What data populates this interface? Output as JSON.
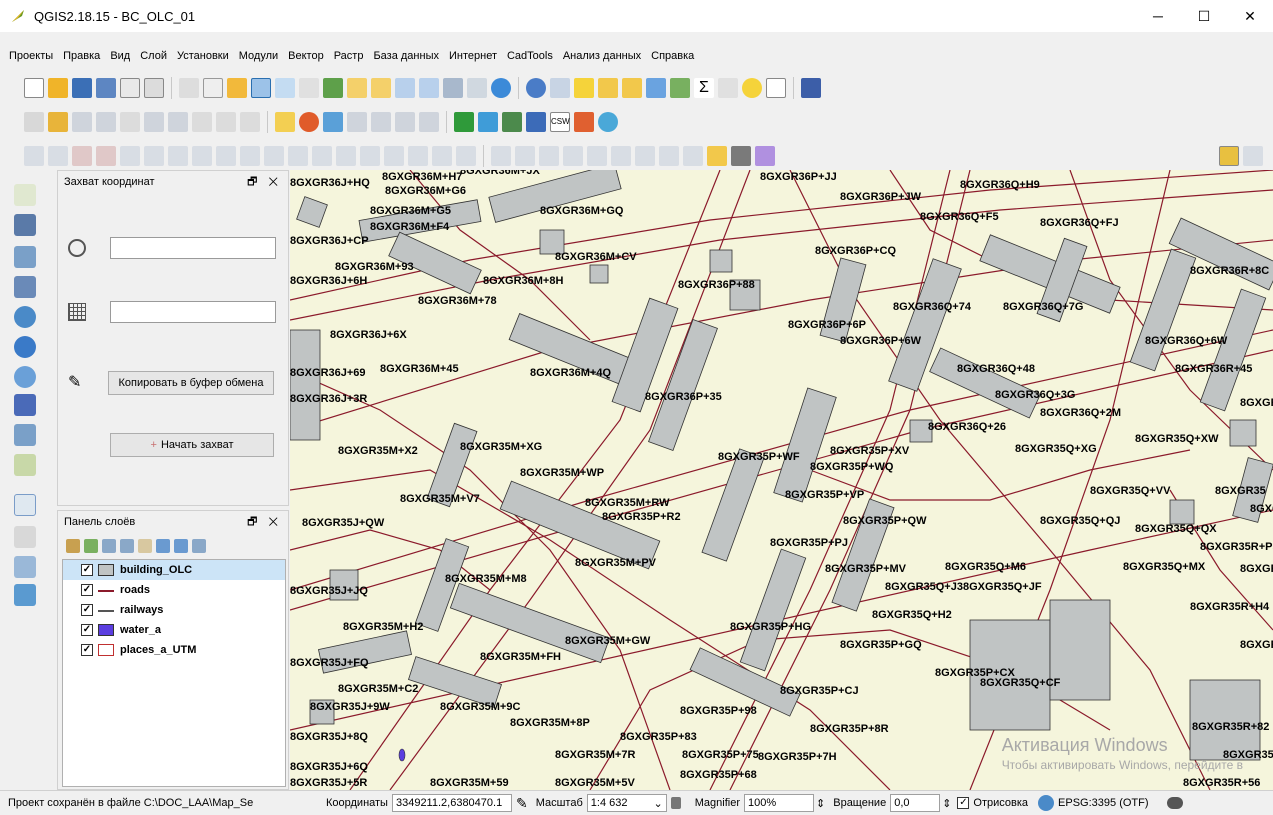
{
  "window": {
    "title": "QGIS2.18.15 - BC_OLC_01",
    "min_glyph": "─",
    "max_glyph": "☐",
    "close_glyph": "✕"
  },
  "menu": [
    "Проекты",
    "Правка",
    "Вид",
    "Слой",
    "Установки",
    "Модули",
    "Вектор",
    "Растр",
    "База данных",
    "Интернет",
    "CadTools",
    "Анализ данных",
    "Справка"
  ],
  "capture_panel": {
    "title": "Захват координат",
    "controls": "🗗 ✕",
    "copy_button": "Копировать в буфер обмена",
    "start_button": "Начать захват"
  },
  "layers_panel": {
    "title": "Панель слоёв",
    "controls": "🗗 ✕",
    "layers": [
      {
        "name": "building_OLC",
        "checked": true,
        "symbol": "building"
      },
      {
        "name": "roads",
        "checked": true,
        "symbol": "road"
      },
      {
        "name": "railways",
        "checked": true,
        "symbol": "rail"
      },
      {
        "name": "water_a",
        "checked": true,
        "symbol": "water"
      },
      {
        "name": "places_a_UTM",
        "checked": true,
        "symbol": "place"
      }
    ]
  },
  "map": {
    "labels": [
      "8GXGR36J+HQ",
      "8GXGR36M+H7",
      "8GXGR36M+JX",
      "8GXGR36P+JJ",
      "8GXGR36Q+H9",
      "8GXGR36M+G6",
      "8GXGR36M+G5",
      "8GXGR36M+GQ",
      "8GXGR36P+JW",
      "8GXGR36Q+F5",
      "8GXGR36Q+FJ",
      "8GXGR36M+F4",
      "8GXGR36J+CP",
      "8GXGR36M+CV",
      "8GXGR36P+CQ",
      "8GXGR36R+8C",
      "8GXGR36M+93",
      "8GXGR36M+8H",
      "8GXGR36P+88",
      "8GXGR36J+6H",
      "8GXGR36M+78",
      "8GXGR36Q+74",
      "8GXGR36Q+7G",
      "8GXGR36P+6P",
      "8GXGR36J+6X",
      "8GXGR36P+6W",
      "8GXGR36Q+6W",
      "8GXGR36J+69",
      "8GXGR36M+45",
      "8GXGR36M+4Q",
      "8GXGR36Q+48",
      "8GXGR36R+45",
      "8GXGR36Q+3G",
      "8GXGR36J+3R",
      "8GXGR36P+35",
      "8GXGR36Q+2M",
      "8GXGR36Q+26",
      "8GXGR3",
      "8GXGR35M+X2",
      "8GXGR35M+XG",
      "8GXGR35P+XV",
      "8GXGR35Q+XW",
      "8GXGR35M+WP",
      "8GXGR35P+WF",
      "8GXGR35P+WQ",
      "8GXGR35Q+XG",
      "8GXGR35M+V7",
      "8GXGR35M+RW",
      "8GXGR35P+VP",
      "8GXGR35Q+VV",
      "8GXGR35",
      "8GXGR35P+R2",
      "8GXGR35J+QW",
      "8GXGR35P+QW",
      "8GXGR35Q+QJ",
      "8GXGR35Q+QX",
      "8GXG",
      "8GXGR35P+PJ",
      "8GXGR35R+P5",
      "8GXGR35M+PV",
      "8GXGR35P+MV",
      "8GXGR35Q+M6",
      "8GXGR35Q+MX",
      "8GXGR",
      "8GXGR35J+JQ",
      "8GXGR35M+M8",
      "8GXGR35Q+J3",
      "8GXGR35Q+JF",
      "8GXGR35R+H4",
      "8GXGR35M+H2",
      "8GXGR35Q+H2",
      "8GXGR35P+HG",
      "8GXGR35M+GW",
      "8GXGR35P+GQ",
      "8GXGR",
      "8GXGR35M+FH",
      "8GXGR35J+FQ",
      "8GXGR35P+CX",
      "8GXGR35Q+CF",
      "8GXGR35M+C2",
      "8GXGR35P+CJ",
      "8GXGR35J+9W",
      "8GXGR35M+9C",
      "8GXGR35P+98",
      "8GXGR35M+8P",
      "8GXGR35P+8R",
      "8GXGR35R+82",
      "8GXGR35J+8Q",
      "8GXGR35P+83",
      "8GXGR35M+7R",
      "8GXGR35P+75",
      "8GXGR35P+7H",
      "8GXGR35R-",
      "8GXGR35J+6Q",
      "8GXGR35P+68",
      "8GXGR35J+5R",
      "8GXGR35M+59",
      "8GXGR35M+5V",
      "8GXGR35R+56"
    ]
  },
  "statusbar": {
    "project_saved": "Проект сохранён в файле C:\\DOC_LAA\\Map_Se",
    "coords_label": "Координаты",
    "coords_value": "3349211.2,6380470.1",
    "scale_label": "Масштаб",
    "scale_value": "1:4 632",
    "magnifier_label": "Magnifier",
    "magnifier_value": "100%",
    "rotation_label": "Вращение",
    "rotation_value": "0,0",
    "render_label": "Отрисовка",
    "crs": "EPSG:3395 (OTF)"
  },
  "watermark": {
    "line1": "Активация Windows",
    "line2": "Чтобы активировать Windows, перейдите в"
  },
  "colors": {
    "map_background": "#f5f5dc",
    "building_fill": "#c0c4c4",
    "road_stroke": "#8b1a2b",
    "water_fill": "#5b3ee0"
  }
}
